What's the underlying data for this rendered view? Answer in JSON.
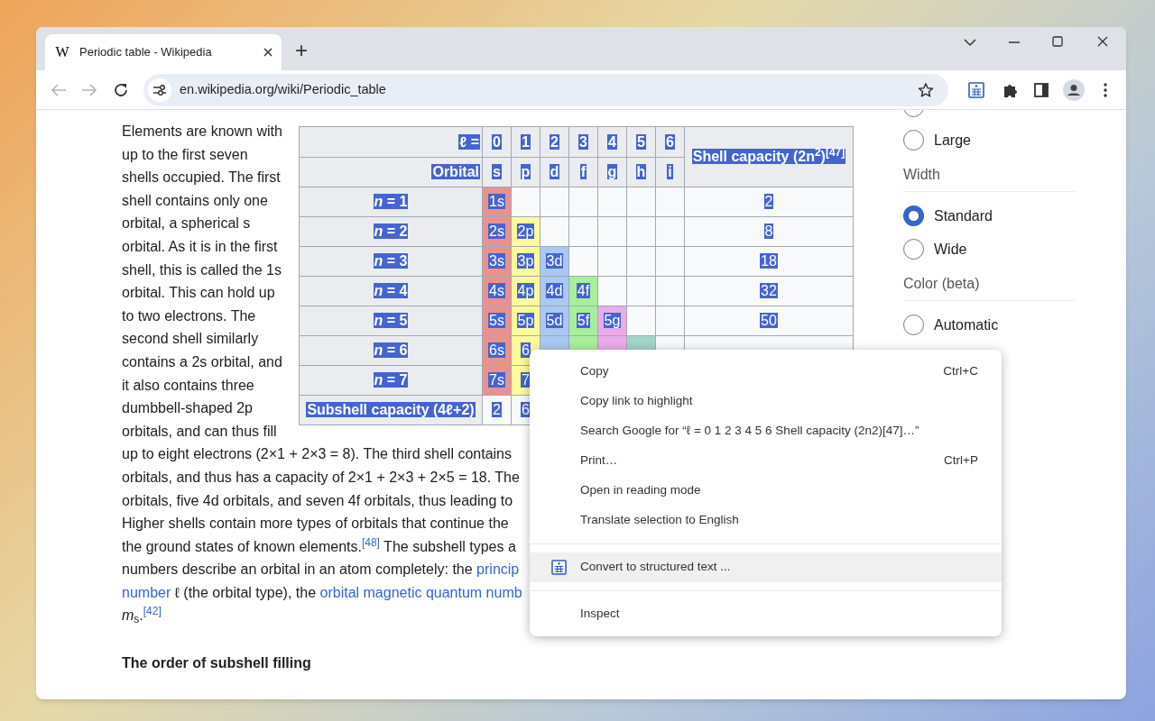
{
  "browser": {
    "tab": {
      "title": "Periodic table - Wikipedia",
      "favicon": "W",
      "selected": true
    },
    "new_tab": "+",
    "nav": {
      "back_disabled": true,
      "forward_disabled": true
    },
    "url": "en.wikipedia.org/wiki/Periodic_table"
  },
  "article": {
    "lines_beside_table": [
      "Elements are known with",
      "up to the first seven",
      "shells occupied. The first",
      "shell contains only one",
      "orbital, a spherical s",
      "orbital. As it is in the first",
      "shell, this is called the 1s",
      "orbital. This can hold up",
      "to two electrons. The",
      "second shell similarly",
      "contains a 2s orbital, and",
      "it also contains three",
      "dumbbell-shaped 2p",
      "orbitals, and can thus fill"
    ],
    "lines": [
      [
        {
          "text": "up to eight electrons (2×1 + 2×3 = 8). The third shell contains",
          "link": false
        }
      ],
      [
        {
          "text": "orbitals, and thus has a capacity of 2×1 + 2×3 + 2×5 = 18. The",
          "link": false
        }
      ],
      [
        {
          "text": "orbitals, five 4d orbitals, and seven 4f orbitals, thus leading to",
          "link": false
        }
      ],
      [
        {
          "text": "Higher shells contain more types of orbitals that continue the",
          "link": false
        }
      ],
      [
        {
          "text": "the ground states of known elements.",
          "link": false
        },
        {
          "text": "$^{[48]}$",
          "link": true
        },
        {
          "text": " The subshell types a",
          "link": false
        }
      ],
      [
        {
          "text": "numbers describe an orbital in an atom completely: the ",
          "link": false
        },
        {
          "text": "princip",
          "link": true
        }
      ],
      [
        {
          "text": "number",
          "link": true
        },
        {
          "text": " ℓ (the orbital type), the ",
          "link": false
        },
        {
          "text": "orbital magnetic quantum numb",
          "link": true
        }
      ],
      [
        {
          "text": "*m*$_{s}$.",
          "link": false
        },
        {
          "text": "$^{[42]}$",
          "link": true
        }
      ]
    ],
    "heading": "The order of subshell filling"
  },
  "table": {
    "text_selected": true,
    "l_label": "ℓ =",
    "orbital_label": "Orbital",
    "capacity_header": "Shell capacity (2n$^{2}$)$^{[47]}$",
    "columns": [
      {
        "l": "0",
        "orbital": "s",
        "color": "#e8928f"
      },
      {
        "l": "1",
        "orbital": "p",
        "color": "#fbfb9c"
      },
      {
        "l": "2",
        "orbital": "d",
        "color": "#a9c8f3"
      },
      {
        "l": "3",
        "orbital": "f",
        "color": "#a8ee9c"
      },
      {
        "l": "4",
        "orbital": "g",
        "color": "#ebaaec"
      },
      {
        "l": "5",
        "orbital": "h",
        "color": "#a3d5c8"
      },
      {
        "l": "6",
        "orbital": "i"
      }
    ],
    "rows": [
      {
        "label": "*n* = 1",
        "cells": [
          "1s"
        ],
        "capacity": "2"
      },
      {
        "label": "*n* = 2",
        "cells": [
          "2s",
          "2p"
        ],
        "capacity": "8"
      },
      {
        "label": "*n* = 3",
        "cells": [
          "3s",
          "3p",
          "3d"
        ],
        "capacity": "18"
      },
      {
        "label": "*n* = 4",
        "cells": [
          "4s",
          "4p",
          "4d",
          "4f"
        ],
        "capacity": "32"
      },
      {
        "label": "*n* = 5",
        "cells": [
          "5s",
          "5p",
          "5d",
          "5f",
          "5g"
        ],
        "capacity": "50"
      },
      {
        "label": "*n* = 6",
        "cells": [
          "6s",
          "6"
        ]
      },
      {
        "label": "*n* = 7",
        "cells": [
          "7s",
          "7"
        ]
      }
    ],
    "footer": {
      "label": "Subshell capacity (4ℓ+2)",
      "values": [
        "2",
        "6"
      ]
    }
  },
  "sidebar": {
    "groups": [
      {
        "options": [
          {
            "selected": false
          },
          {
            "label": "Large",
            "selected": false
          }
        ]
      },
      {
        "heading": "Width",
        "options": [
          {
            "label": "Standard",
            "selected": true
          },
          {
            "label": "Wide",
            "selected": false
          }
        ]
      },
      {
        "heading": "Color (beta)",
        "options": [
          {
            "label": "Automatic",
            "selected": false
          }
        ]
      }
    ]
  },
  "context_menu": {
    "items": [
      {
        "kind": "command",
        "label": "Copy",
        "shortcut": "Ctrl+C",
        "selected": false
      },
      {
        "kind": "command",
        "label": "Copy link to highlight",
        "selected": false
      },
      {
        "kind": "command",
        "label": "Search Google for “ℓ = 0 1 2 3 4 5 6 Shell capacity (2n2)[47]…”",
        "selected": false
      },
      {
        "kind": "command",
        "label": "Print…",
        "shortcut": "Ctrl+P",
        "selected": false
      },
      {
        "kind": "command",
        "label": "Open in reading mode",
        "selected": false
      },
      {
        "kind": "command",
        "label": "Translate selection to English",
        "selected": false
      },
      {
        "kind": "separator"
      },
      {
        "kind": "extension",
        "label": "Convert to structured text ...",
        "selected": true
      },
      {
        "kind": "separator"
      },
      {
        "kind": "command",
        "label": "Inspect",
        "selected": false
      }
    ]
  }
}
